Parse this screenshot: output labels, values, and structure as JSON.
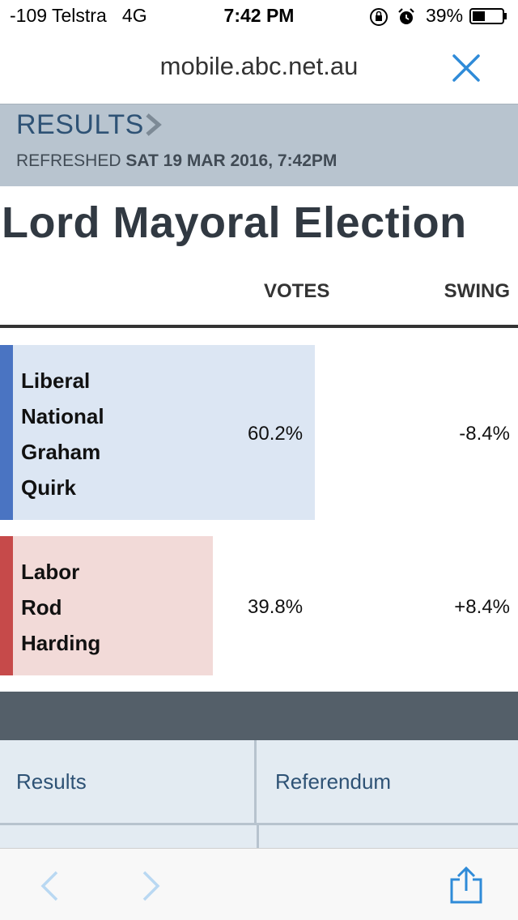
{
  "status_bar": {
    "carrier": "-109 Telstra   4G",
    "time": "7:42 PM",
    "battery": "39%"
  },
  "browser": {
    "url": "mobile.abc.net.au"
  },
  "results_header": {
    "link_label": "RESULTS",
    "refreshed_label": "REFRESHED",
    "refreshed_time": "SAT 19 MAR 2016, 7:42PM"
  },
  "page": {
    "title": "Lord Mayoral Election",
    "columns": {
      "votes": "VOTES",
      "swing": "SWING"
    }
  },
  "candidates": [
    {
      "name_lines": [
        "Liberal",
        "National",
        "Graham",
        "Quirk"
      ],
      "votes": "60.2%",
      "swing": "-8.4%",
      "vote_share": 60.2,
      "bar_color": "#4a74c2",
      "fill_color": "#dce6f3"
    },
    {
      "name_lines": [
        "Labor",
        "Rod",
        "Harding"
      ],
      "votes": "39.8%",
      "swing": "+8.4%",
      "vote_share": 39.8,
      "bar_color": "#c64a4a",
      "fill_color": "#f2dad8"
    }
  ],
  "nav": {
    "items": [
      "Results",
      "Referendum"
    ]
  },
  "colors": {
    "accent": "#2f8bd8",
    "header_bg": "#b8c4cf",
    "dark_band": "#545f69",
    "nav_bg": "#e3ebf2"
  }
}
